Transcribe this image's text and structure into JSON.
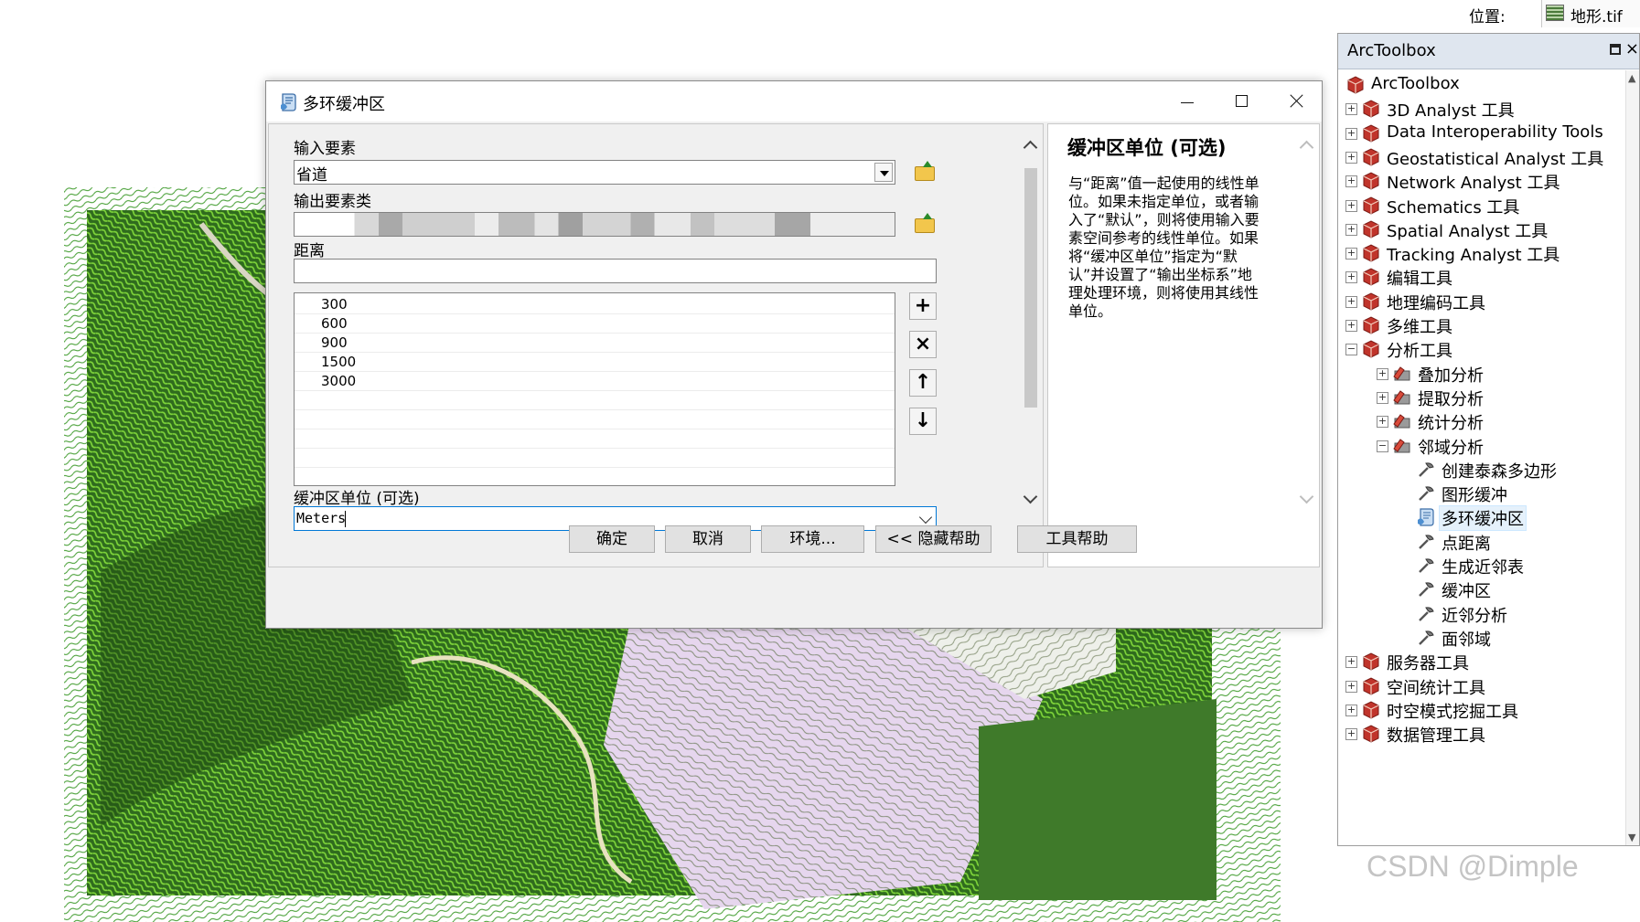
{
  "location_bar": {
    "label": "位置:",
    "value": "地形.tif"
  },
  "toolbox": {
    "title": "ArcToolbox",
    "items": [
      {
        "label": "ArcToolbox",
        "level": 0,
        "expander": ""
      },
      {
        "label": "3D Analyst 工具",
        "level": 1,
        "expander": "+"
      },
      {
        "label": "Data Interoperability Tools",
        "level": 1,
        "expander": "+"
      },
      {
        "label": "Geostatistical Analyst 工具",
        "level": 1,
        "expander": "+"
      },
      {
        "label": "Network Analyst 工具",
        "level": 1,
        "expander": "+"
      },
      {
        "label": "Schematics 工具",
        "level": 1,
        "expander": "+"
      },
      {
        "label": "Spatial Analyst 工具",
        "level": 1,
        "expander": "+"
      },
      {
        "label": "Tracking Analyst 工具",
        "level": 1,
        "expander": "+"
      },
      {
        "label": "编辑工具",
        "level": 1,
        "expander": "+"
      },
      {
        "label": "地理编码工具",
        "level": 1,
        "expander": "+"
      },
      {
        "label": "多维工具",
        "level": 1,
        "expander": "+"
      },
      {
        "label": "分析工具",
        "level": 1,
        "expander": "-"
      },
      {
        "label": "叠加分析",
        "level": 2,
        "expander": "+"
      },
      {
        "label": "提取分析",
        "level": 2,
        "expander": "+"
      },
      {
        "label": "统计分析",
        "level": 2,
        "expander": "+"
      },
      {
        "label": "邻域分析",
        "level": 2,
        "expander": "-"
      },
      {
        "label": "创建泰森多边形",
        "level": 3,
        "expander": ""
      },
      {
        "label": "图形缓冲",
        "level": 3,
        "expander": ""
      },
      {
        "label": "多环缓冲区",
        "level": 3,
        "expander": "",
        "selected": true
      },
      {
        "label": "点距离",
        "level": 3,
        "expander": ""
      },
      {
        "label": "生成近邻表",
        "level": 3,
        "expander": ""
      },
      {
        "label": "缓冲区",
        "level": 3,
        "expander": ""
      },
      {
        "label": "近邻分析",
        "level": 3,
        "expander": ""
      },
      {
        "label": "面邻域",
        "level": 3,
        "expander": ""
      },
      {
        "label": "服务器工具",
        "level": 1,
        "expander": "+"
      },
      {
        "label": "空间统计工具",
        "level": 1,
        "expander": "+"
      },
      {
        "label": "时空模式挖掘工具",
        "level": 1,
        "expander": "+"
      },
      {
        "label": "数据管理工具",
        "level": 1,
        "expander": "+"
      }
    ]
  },
  "dialog": {
    "title": "多环缓冲区",
    "params": {
      "input_label": "输入要素",
      "input_value": "省道",
      "output_label": "输出要素类",
      "distance_label": "距离",
      "distance_input": "",
      "distance_values": [
        "300",
        "600",
        "900",
        "1500",
        "3000"
      ],
      "units_label": "缓冲区单位 (可选)",
      "units_value": "Meters"
    },
    "list_buttons": {
      "add": "+",
      "delete": "×",
      "up": "↑",
      "down": "↓"
    },
    "help": {
      "title": "缓冲区单位 (可选)",
      "body": "与“距离”值一起使用的线性单位。如果未指定单位，或者输入了“默认”，则将使用输入要素空间参考的线性单位。如果将“缓冲区单位”指定为“默认”并设置了“输出坐标系”地理处理环境，则将使用其线性单位。"
    },
    "buttons": {
      "ok": "确定",
      "cancel": "取消",
      "environments": "环境...",
      "hide_help": "<< 隐藏帮助",
      "tool_help": "工具帮助"
    }
  },
  "watermark": "CSDN @Dimple"
}
